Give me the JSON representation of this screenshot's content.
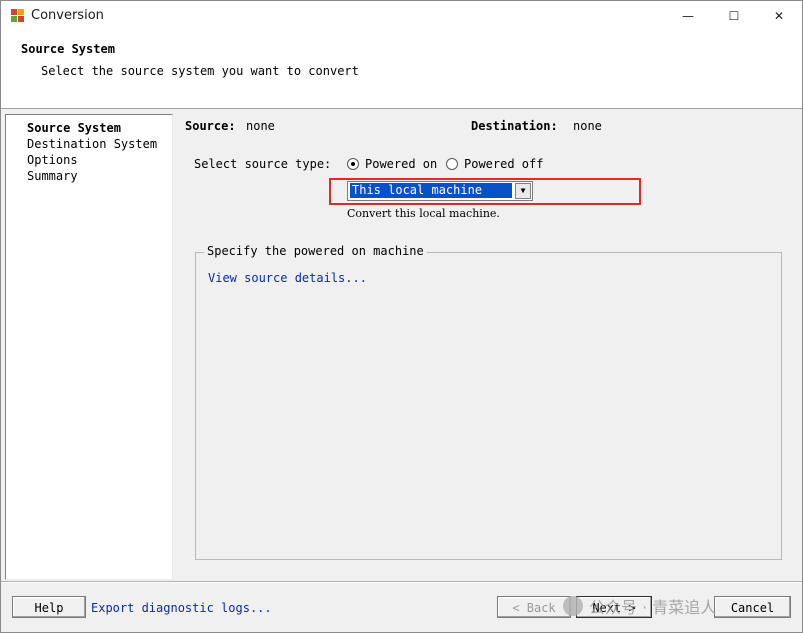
{
  "window": {
    "title": "Conversion",
    "controls": {
      "minimize": "—",
      "maximize": "☐",
      "close": "✕"
    }
  },
  "header": {
    "title": "Source System",
    "subtitle": "Select the source system you want to convert"
  },
  "nav": {
    "items": [
      {
        "label": "Source System",
        "active": true
      },
      {
        "label": "Destination System",
        "active": false
      },
      {
        "label": "Options",
        "active": false
      },
      {
        "label": "Summary",
        "active": false
      }
    ]
  },
  "summary": {
    "source_label": "Source:",
    "source_value": "none",
    "destination_label": "Destination:",
    "destination_value": "none"
  },
  "source_type": {
    "label": "Select source type:",
    "options": [
      {
        "label": "Powered on",
        "selected": true
      },
      {
        "label": "Powered off",
        "selected": false
      }
    ],
    "dropdown_value": "This local machine",
    "dropdown_arrow": "▼",
    "description": "Convert this local machine."
  },
  "group": {
    "title": "Specify the powered on machine",
    "link": "View source details..."
  },
  "footer": {
    "help": "Help",
    "export_link": "Export diagnostic logs...",
    "back": "< Back",
    "next": "Next >",
    "cancel": "Cancel"
  },
  "watermark": "公众号 · 青菜追人",
  "colors": {
    "highlight_border": "#e02a2a",
    "selection": "#0a50c8",
    "link": "#0a2aa8"
  }
}
